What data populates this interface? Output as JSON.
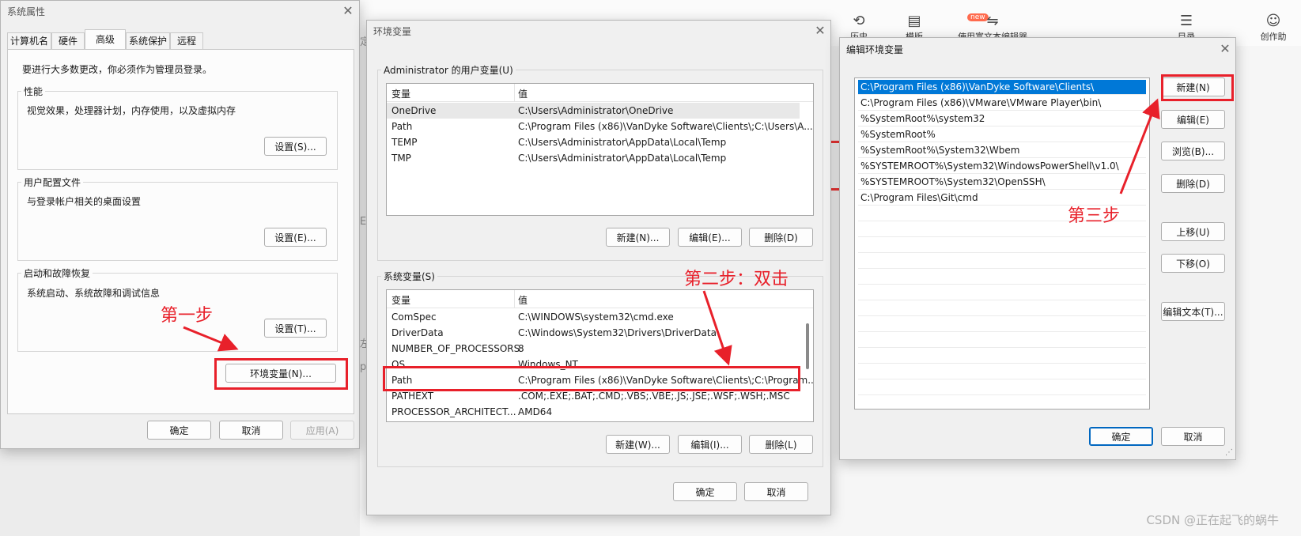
{
  "background": {
    "toolbar_items": [
      {
        "label": "历史",
        "icon": "history-icon"
      },
      {
        "label": "模版",
        "icon": "template-icon"
      },
      {
        "label": "使用富文本编辑器",
        "icon": "swap-icon"
      },
      {
        "label": "目录",
        "icon": "outline-icon"
      },
      {
        "label": "创作助",
        "icon": "robot-icon"
      }
    ],
    "new_badge": "new",
    "side_glyphs": [
      "定",
      "左",
      "p",
      "E"
    ]
  },
  "sys_props": {
    "title": "系统属性",
    "tabs": [
      "计算机名",
      "硬件",
      "高级",
      "系统保护",
      "远程"
    ],
    "active_tab": "高级",
    "notice": "要进行大多数更改，你必须作为管理员登录。",
    "performance": {
      "label": "性能",
      "desc": "视觉效果，处理器计划，内存使用，以及虚拟内存",
      "button": "设置(S)..."
    },
    "profile": {
      "label": "用户配置文件",
      "desc": "与登录帐户相关的桌面设置",
      "button": "设置(E)..."
    },
    "startup": {
      "label": "启动和故障恢复",
      "desc": "系统启动、系统故障和调试信息",
      "button": "设置(T)..."
    },
    "env_button": "环境变量(N)...",
    "ok": "确定",
    "cancel": "取消",
    "apply": "应用(A)"
  },
  "env_vars": {
    "title": "环境变量",
    "user_label": "Administrator 的用户变量(U)",
    "col_var": "变量",
    "col_val": "值",
    "user_rows": [
      {
        "name": "OneDrive",
        "value": "C:\\Users\\Administrator\\OneDrive"
      },
      {
        "name": "Path",
        "value": "C:\\Program Files (x86)\\VanDyke Software\\Clients\\;C:\\Users\\A..."
      },
      {
        "name": "TEMP",
        "value": "C:\\Users\\Administrator\\AppData\\Local\\Temp"
      },
      {
        "name": "TMP",
        "value": "C:\\Users\\Administrator\\AppData\\Local\\Temp"
      }
    ],
    "user_buttons": [
      "新建(N)...",
      "编辑(E)...",
      "删除(D)"
    ],
    "sys_label": "系统变量(S)",
    "sys_rows": [
      {
        "name": "ComSpec",
        "value": "C:\\WINDOWS\\system32\\cmd.exe"
      },
      {
        "name": "DriverData",
        "value": "C:\\Windows\\System32\\Drivers\\DriverData"
      },
      {
        "name": "NUMBER_OF_PROCESSORS",
        "value": "8"
      },
      {
        "name": "OS",
        "value": "Windows_NT"
      },
      {
        "name": "Path",
        "value": "C:\\Program Files (x86)\\VanDyke Software\\Clients\\;C:\\Program..."
      },
      {
        "name": "PATHEXT",
        "value": ".COM;.EXE;.BAT;.CMD;.VBS;.VBE;.JS;.JSE;.WSF;.WSH;.MSC"
      },
      {
        "name": "PROCESSOR_ARCHITECT...",
        "value": "AMD64"
      }
    ],
    "sys_buttons": [
      "新建(W)...",
      "编辑(I)...",
      "删除(L)"
    ],
    "ok": "确定",
    "cancel": "取消"
  },
  "edit_env": {
    "title": "编辑环境变量",
    "paths": [
      "C:\\Program Files (x86)\\VanDyke Software\\Clients\\",
      "C:\\Program Files (x86)\\VMware\\VMware Player\\bin\\",
      "%SystemRoot%\\system32",
      "%SystemRoot%",
      "%SystemRoot%\\System32\\Wbem",
      "%SYSTEMROOT%\\System32\\WindowsPowerShell\\v1.0\\",
      "%SYSTEMROOT%\\System32\\OpenSSH\\",
      "C:\\Program Files\\Git\\cmd"
    ],
    "buttons": [
      "新建(N)",
      "编辑(E)",
      "浏览(B)...",
      "删除(D)",
      "上移(U)",
      "下移(O)",
      "编辑文本(T)..."
    ],
    "ok": "确定",
    "cancel": "取消"
  },
  "annotations": {
    "step1": "第一步",
    "step2": "第二步：双击",
    "step3": "第三步"
  },
  "annotation_color": "#e8202a",
  "watermark": "CSDN @正在起飞的蜗牛"
}
